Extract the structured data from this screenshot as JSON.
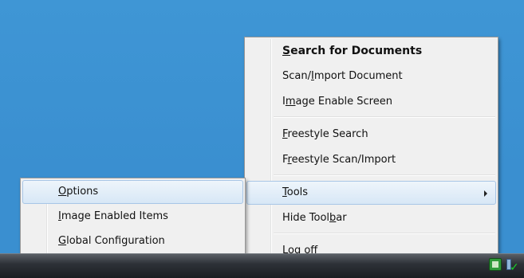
{
  "context_menu": {
    "items": [
      {
        "pre": "",
        "key": "S",
        "post": "earch for Documents"
      },
      {
        "pre": "Scan/",
        "key": "I",
        "post": "mport Document"
      },
      {
        "pre": "I",
        "key": "m",
        "post": "age Enable Screen"
      },
      {
        "pre": "",
        "key": "F",
        "post": "reestyle Search"
      },
      {
        "pre": "F",
        "key": "r",
        "post": "eestyle Scan/Import"
      },
      {
        "pre": "",
        "key": "T",
        "post": "ools"
      },
      {
        "pre": "Hide Tool",
        "key": "b",
        "post": "ar"
      },
      {
        "pre": "",
        "key": "L",
        "post": "og off"
      }
    ]
  },
  "submenu": {
    "items": [
      {
        "pre": "",
        "key": "O",
        "post": "ptions"
      },
      {
        "pre": "",
        "key": "I",
        "post": "mage Enabled Items"
      },
      {
        "pre": "",
        "key": "G",
        "post": "lobal Configuration"
      }
    ]
  },
  "colors": {
    "desktop": "#3a8fd0",
    "menu_bg": "#f0f0f0",
    "highlight": "#d7e7f6"
  }
}
